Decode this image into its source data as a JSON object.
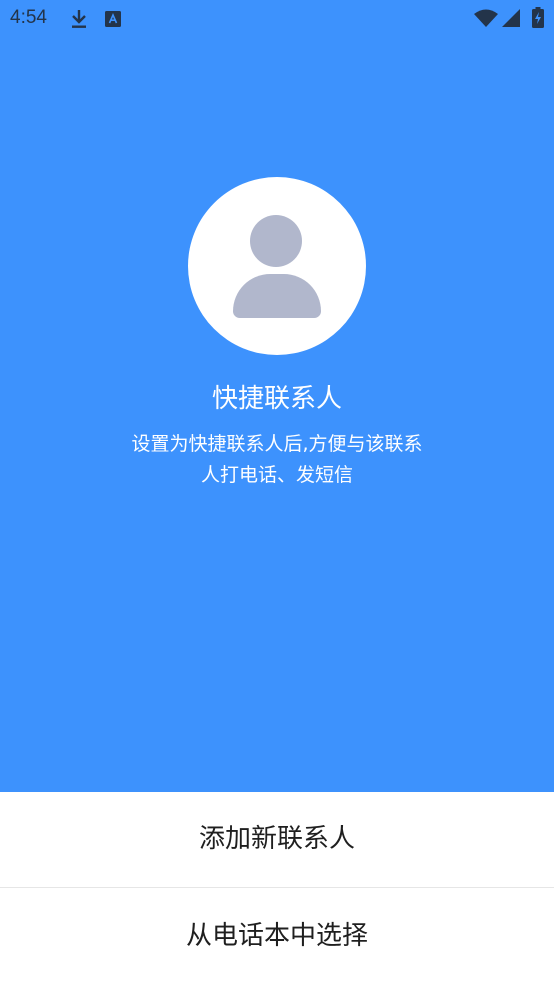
{
  "status_bar": {
    "time": "4:54",
    "icons": [
      "download-icon",
      "translate-app-icon",
      "wifi-icon",
      "cell-signal-icon",
      "battery-charging-icon"
    ]
  },
  "colors": {
    "primary_blue": "#3d92fd",
    "avatar_gray": "#b1b7cc",
    "status_text": "#23344a"
  },
  "header": {
    "avatar_icon": "person-avatar-icon",
    "title": "快捷联系人",
    "description": "设置为快捷联系人后,方便与该联系人打电话、发短信"
  },
  "actions": {
    "add_new_contact": "添加新联系人",
    "choose_from_phonebook": "从电话本中选择"
  }
}
